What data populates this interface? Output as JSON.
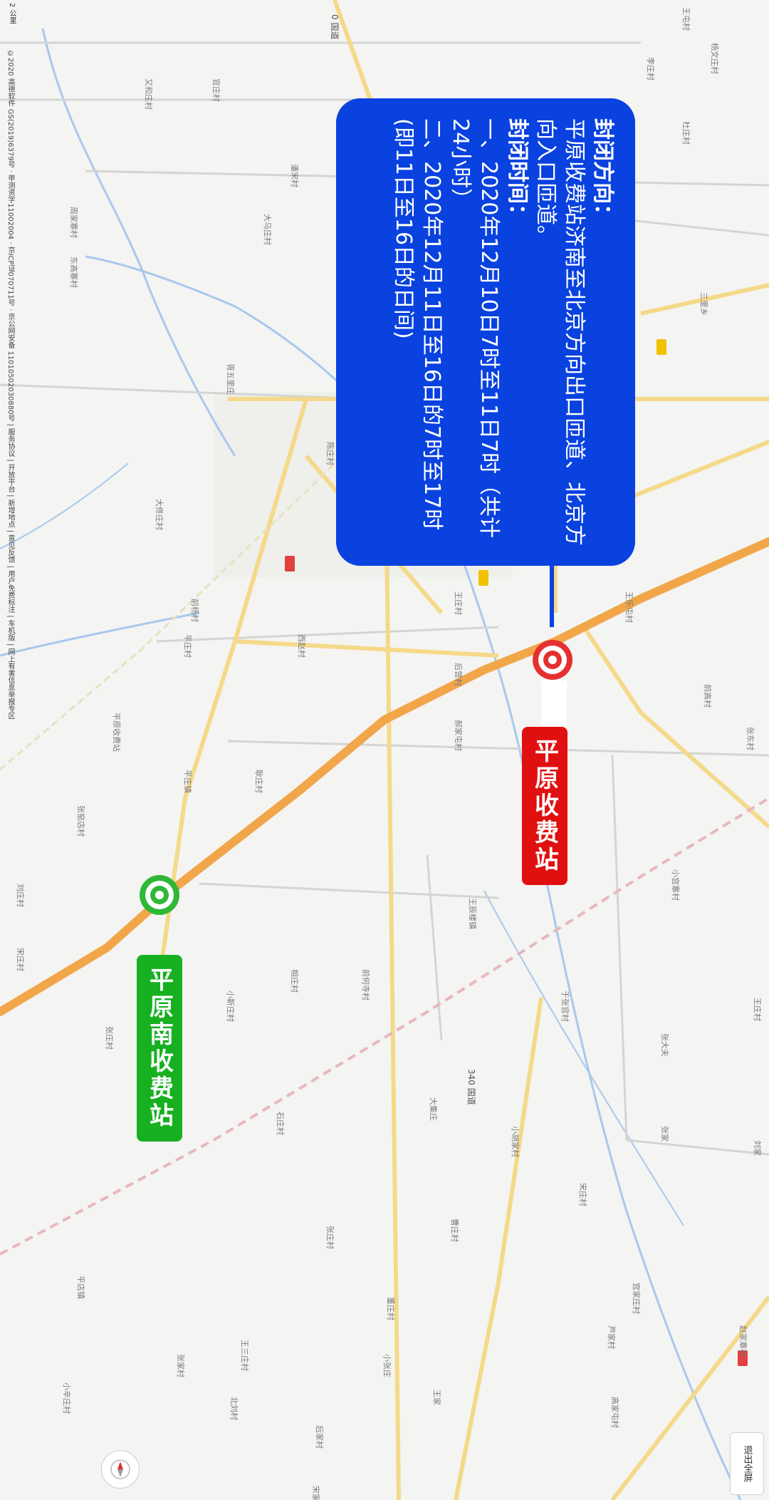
{
  "callout": {
    "heading1": "封闭方向：",
    "line1": "平原收费站济南至北京方向出口匝道、北京方向入口匝道。",
    "heading2": "封闭时间：",
    "line2": "一、2020年12月10日7时至11日7时（共计24小时）",
    "line3": "二、2020年12月11日至16日的7时至17时(即11日至16日的日间)"
  },
  "stations": {
    "red_label": "平原收费站",
    "green_label": "平原南收费站"
  },
  "controls": {
    "exit_fullscreen": "退出全屏",
    "scale": "2 公里"
  },
  "attribution": "©2020 高德软件 GS(2019)6379号 · 甲测资字11002004 · 京ICP证070711号 · 京公网安备 11010502030880号 | 服务协议 | 开放平台 | 新增地点 | 意见反馈 | 用户免费标注 | 车机版 | 网上有害信息举报专区",
  "roads": {
    "national_340": "340 国道",
    "national_0": "0 国道"
  },
  "places": [
    "王屯村",
    "李庄村",
    "杨文庄村",
    "又和庄村",
    "官庄村",
    "杜庄村",
    "潘宋村",
    "周家寨村",
    "大马庄村",
    "东高寨村",
    "三里乡",
    "胥五里庄",
    "陈庄村",
    "大佟庄村",
    "王乐屯村",
    "前杨村",
    "平庄村",
    "西赵村",
    "后营村",
    "王庄村",
    "前高村",
    "张窑店村",
    "刘庄村",
    "宋庄村",
    "相庄村",
    "耿庄村",
    "郝家屯村",
    "张东村",
    "小靳庄村",
    "张庄村",
    "王辰楼镇",
    "前何寺村",
    "于张官村",
    "小宫寨村",
    "王庄村",
    "张大夫",
    "张家",
    "小胡家村",
    "宋庄村",
    "刘家",
    "平店镇",
    "石庄村",
    "王三庄村",
    "张庄村",
    "大集庄",
    "曹庄村",
    "董庄村",
    "小张庄",
    "王家",
    "后家村",
    "小辛庄村",
    "张家村",
    "北刘村",
    "宋家",
    "宫家庄村",
    "芦家村",
    "高家屯村",
    "赵家寨村",
    "平原收费站",
    "平庄镇"
  ]
}
